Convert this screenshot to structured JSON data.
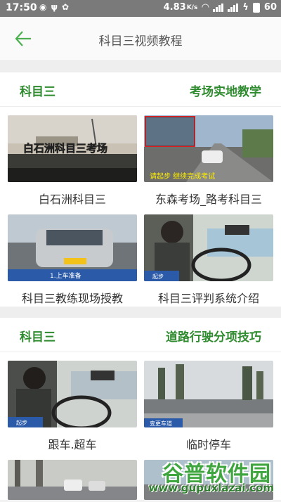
{
  "status_bar": {
    "time": "17:50",
    "speed": "4.83",
    "speed_unit": "K/s",
    "battery": "60"
  },
  "header": {
    "title": "科目三视频教程"
  },
  "sections": [
    {
      "left": "科目三",
      "right": "考场实地教学",
      "items": [
        {
          "caption": "白石洲科目三",
          "thumb_text": "白石洲科目三考场"
        },
        {
          "caption": "东森考场_路考科目三",
          "thumb_text": "请起步  继续完成考试"
        },
        {
          "caption": "科目三教练现场授教",
          "thumb_text": "1.上车准备"
        },
        {
          "caption": "科目三评判系统介绍",
          "thumb_text": "起步"
        }
      ]
    },
    {
      "left": "科目三",
      "right": "道路行驶分项技巧",
      "items": [
        {
          "caption": "跟车.超车",
          "thumb_text": "起步"
        },
        {
          "caption": "临时停车",
          "thumb_text": "变更车道"
        }
      ]
    }
  ],
  "watermark": {
    "name": "谷普软件园",
    "url": "www.gupuxlazai.com"
  }
}
